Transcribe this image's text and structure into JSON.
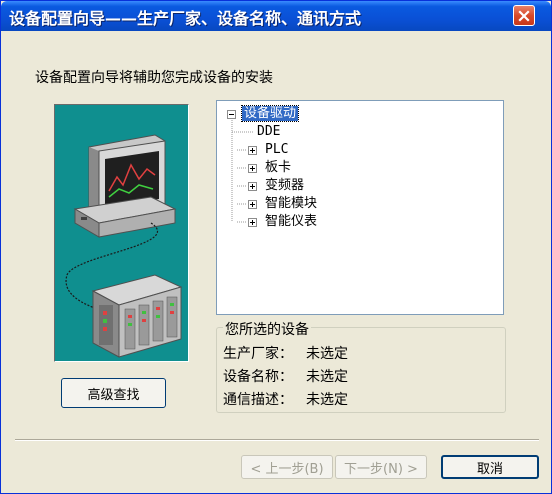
{
  "window": {
    "title": "设备配置向导——生产厂家、设备名称、通讯方式",
    "close_icon": "close-icon"
  },
  "subtitle": "设备配置向导将辅助您完成设备的安装",
  "tree": {
    "root": {
      "label": "设备驱动",
      "expanded": true
    },
    "items": [
      {
        "label": "DDE",
        "expandable": false
      },
      {
        "label": "PLC",
        "expandable": true
      },
      {
        "label": "板卡",
        "expandable": true
      },
      {
        "label": "变频器",
        "expandable": true
      },
      {
        "label": "智能模块",
        "expandable": true
      },
      {
        "label": "智能仪表",
        "expandable": true
      }
    ]
  },
  "selected_device": {
    "legend": "您所选的设备",
    "rows": [
      {
        "label": "生产厂家：",
        "value": "未选定"
      },
      {
        "label": "设备名称：",
        "value": "未选定"
      },
      {
        "label": "通信描述：",
        "value": "未选定"
      }
    ]
  },
  "buttons": {
    "advanced_search": "高级查找",
    "back": "< 上一步(B)",
    "next": "下一步(N) >",
    "cancel": "取消"
  },
  "colors": {
    "titlebar": "#0a50d6",
    "window_bg": "#ece9d8",
    "illustration_bg": "#0f8f8f",
    "selection": "#316ac5"
  }
}
